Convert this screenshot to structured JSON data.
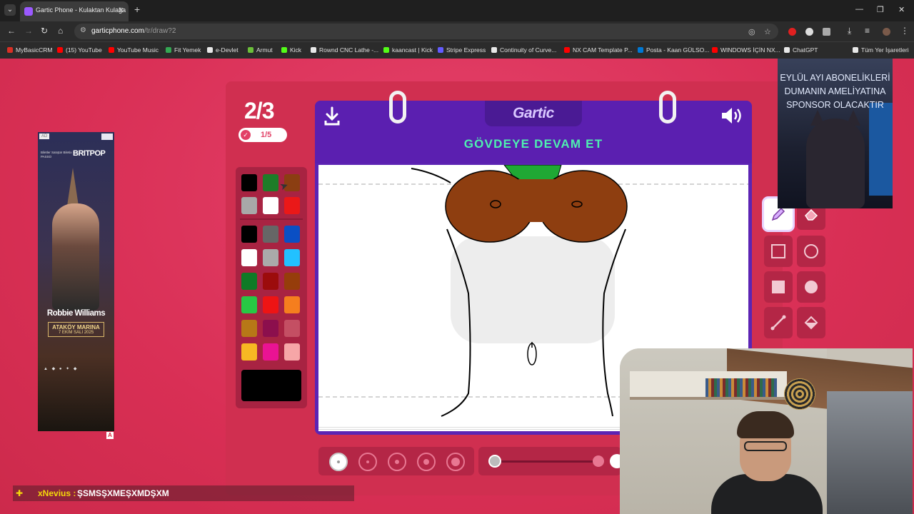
{
  "browser": {
    "tab_title": "Gartic Phone - Kulaktan Kulağa",
    "url_domain": "garticphone.com",
    "url_path": "/tr/draw?2",
    "bookmarks": [
      {
        "label": "MyBasicCRM",
        "color": "#d93025"
      },
      {
        "label": "(15) YouTube",
        "color": "#ff0000"
      },
      {
        "label": "YouTube Music",
        "color": "#ff0000"
      },
      {
        "label": "Fit Yemek",
        "color": "#34a853"
      },
      {
        "label": "e-Devlet",
        "color": "#e8e8e8"
      },
      {
        "label": "Armut",
        "color": "#6bbf3a"
      },
      {
        "label": "Kick",
        "color": "#53fc18"
      },
      {
        "label": "Rownd CNC Lathe -...",
        "color": "#e8e8e8"
      },
      {
        "label": "kaancast | Kick",
        "color": "#53fc18"
      },
      {
        "label": "Stripe Express",
        "color": "#635bff"
      },
      {
        "label": "Continuity of Curve...",
        "color": "#e8e8e8"
      },
      {
        "label": "NX CAM Template P...",
        "color": "#ff0000"
      },
      {
        "label": "Posta - Kaan GÜLSO...",
        "color": "#0078d4"
      },
      {
        "label": "WINDOWS İÇİN NX...",
        "color": "#ff0000"
      },
      {
        "label": "ChatGPT",
        "color": "#e8e8e8"
      },
      {
        "label": "Tüm Yer İşaretleri",
        "color": "#e8e8e8"
      }
    ]
  },
  "ad": {
    "tag": "AD",
    "mini_text": "Biletler Satışta! Biletix · PASSO",
    "brand": "BRITPOP",
    "artist": "Robbie Williams",
    "venue": "ATAKÖY MARINA",
    "date": "7 EKİM SALI 2025",
    "badge": "A"
  },
  "game": {
    "round": "2/3",
    "progress": "1/5",
    "logo": "Gartic",
    "instruction": "GÖVDEYE DEVAM ET",
    "palette_top": [
      "#000000",
      "#1e7d28",
      "#8b3e12",
      "#a8a8a8",
      "#ffffff",
      "#ea1818"
    ],
    "palette": [
      "#000000",
      "#666666",
      "#0a4fc4",
      "#ffffff",
      "#aaaaaa",
      "#22c1ff",
      "#0f7a26",
      "#9c0c0c",
      "#963d0b",
      "#28c844",
      "#ee1414",
      "#f57e1e",
      "#b77817",
      "#8c0f4d",
      "#c44f63",
      "#f7b823",
      "#ea1393",
      "#f6a6a7"
    ],
    "current_color": "#000000",
    "opacity_percent": 100
  },
  "chat": {
    "icon": "✚",
    "user": "xNevius :",
    "message": "ŞSMSŞXMEŞXMDŞXM"
  },
  "overlay": {
    "subscriber_text": "EYLÜL AYI ABONELİKLERİ DUMANIN AMELİYATINA SPONSOR OLACAKTIR"
  }
}
